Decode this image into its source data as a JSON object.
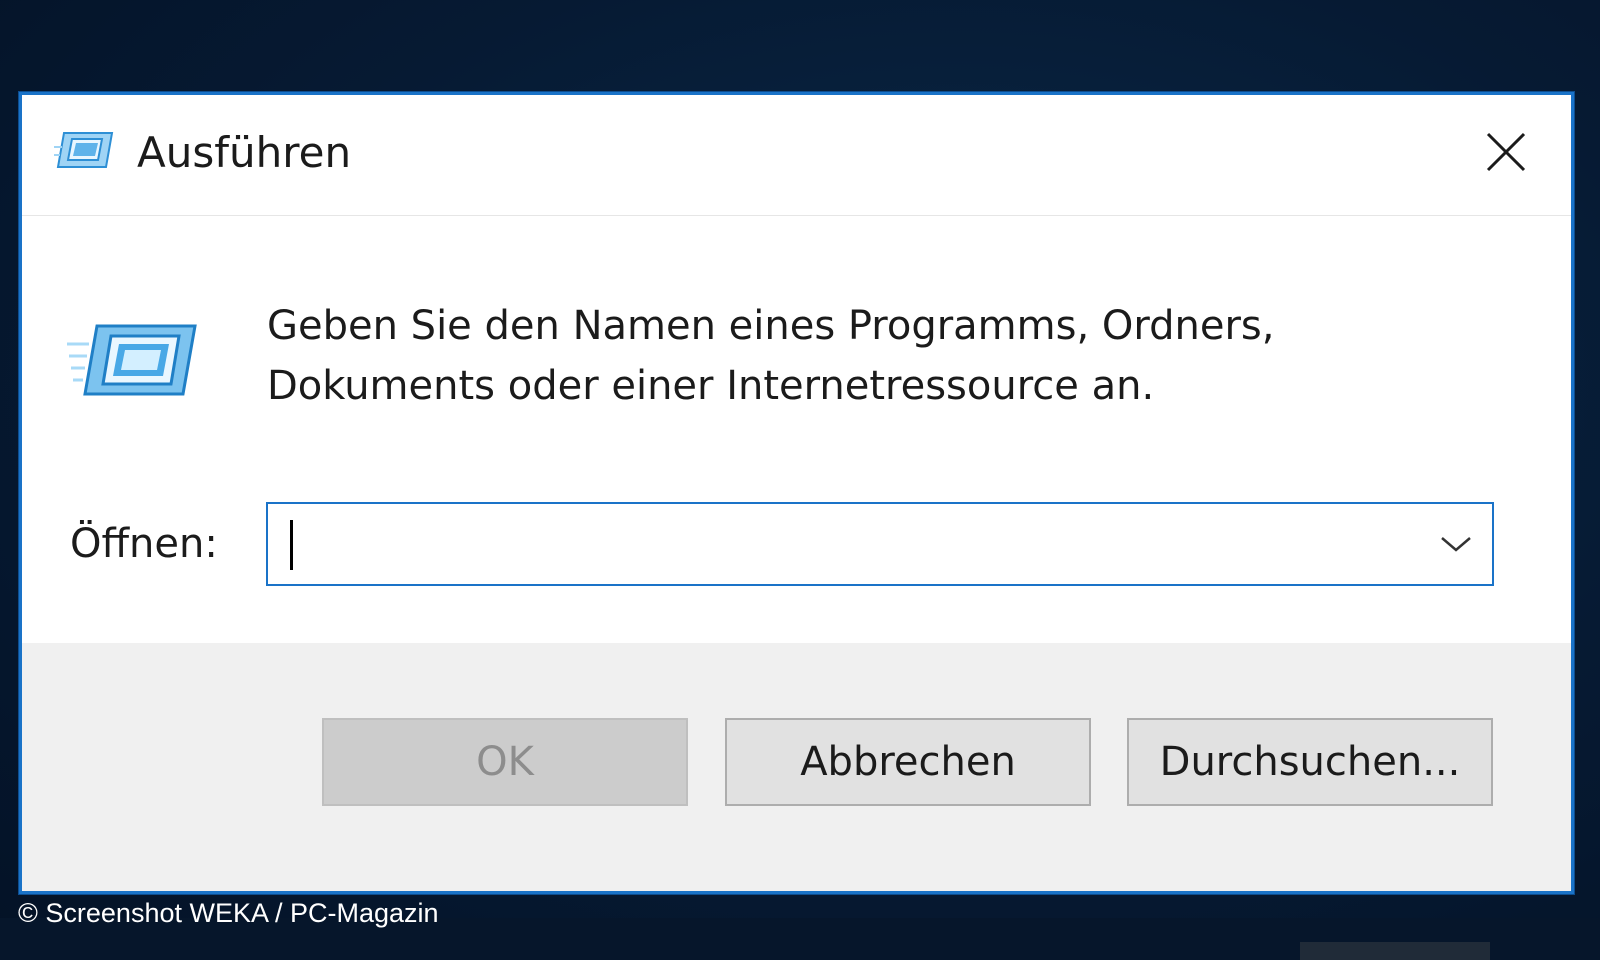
{
  "window": {
    "title": "Ausführen",
    "icon": "run-icon"
  },
  "content": {
    "description_line1": "Geben Sie den Namen eines Programms, Ordners,",
    "description_line2": "Dokuments oder einer Internetressource an.",
    "open_label": "Öffnen:",
    "open_value": "",
    "open_placeholder": ""
  },
  "buttons": {
    "ok": "OK",
    "cancel": "Abbrechen",
    "browse": "Durchsuchen..."
  },
  "watermark": "© Screenshot WEKA / PC-Magazin",
  "colors": {
    "accent": "#1a73c8",
    "desktop": "#061a33",
    "footer": "#f0f0f0"
  }
}
